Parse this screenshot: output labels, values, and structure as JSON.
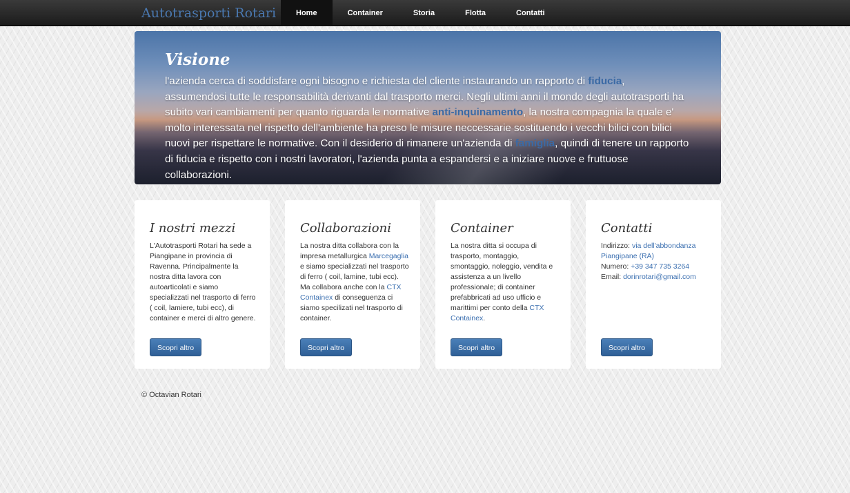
{
  "brand": "Autotrasporti Rotari",
  "nav": {
    "items": [
      "Home",
      "Container",
      "Storia",
      "Flotta",
      "Contatti"
    ],
    "active": "Home"
  },
  "hero": {
    "title": "Visione",
    "text_1": "l'azienda cerca di soddisfare ogni bisogno e richiesta del cliente instaurando un rapporto di ",
    "link_1": "fiducia",
    "text_2": ", assumendosi tutte le responsabilità derivanti dal trasporto merci. Negli ultimi anni il mondo degli autotrasporti ha subito vari cambiamenti per quanto riguarda le normative ",
    "link_2": "anti-inquinamento",
    "text_3": ", la nostra compagnia la quale e' molto interessata nel rispetto dell'ambiente ha preso le misure neccessarie sostituendo i vecchi bilici con bilici nuovi per rispettare le normative. Con il desiderio di rimanere un'azienda di ",
    "link_3": "famiglia",
    "text_4": ", quindi di tenere un rapporto di fiducia e rispetto con i nostri lavoratori, l'azienda punta a espandersi e a iniziare nuove e fruttuose collaborazioni."
  },
  "cards": {
    "mezzi": {
      "title": "I nostri mezzi",
      "text": "L'Autotrasporti Rotari ha sede a Piangipane in provincia di Ravenna. Principalmente la nostra ditta lavora con autoarticolati e siamo specializzati nel trasporto di ferro ( coil, lamiere, tubi ecc), di container e merci di altro genere.",
      "button": "Scopri altro"
    },
    "collaborazioni": {
      "title": "Collaborazioni",
      "text_1": "La nostra ditta collabora con la impresa metallurgica ",
      "link_1": "Marcegaglia",
      "text_2": " e siamo specializzati nel trasporto di ferro ( coil, lamine, tubi ecc). Ma collabora anche con la ",
      "link_2": "CTX Containex",
      "text_3": " di conseguenza ci siamo specilizati nel trasporto di container.",
      "button": "Scopri altro"
    },
    "container": {
      "title": "Container",
      "text_1": "La nostra ditta si occupa di trasporto, montaggio, smontaggio, noleggio, vendita e assistenza a un livello professionale; di container prefabbricati ad uso ufficio e marittimi per conto della ",
      "link_1": "CTX Containex",
      "text_2": ".",
      "button": "Scopri altro"
    },
    "contatti": {
      "title": "Contatti",
      "address_label": "Indirizzo: ",
      "address": "via dell'abbondanza Piangipane (RA)",
      "phone_label": "Numero: ",
      "phone": "+39 347 735 3264",
      "email_label": "Email: ",
      "email": "dorinrotari@gmail.com",
      "button": "Scopri altro"
    }
  },
  "footer": "© Octavian Rotari",
  "colors": {
    "navbar": "#1b1b1b",
    "brand": "#4a78b0",
    "link": "#3b6fb0",
    "button": "#3a6ea5"
  }
}
